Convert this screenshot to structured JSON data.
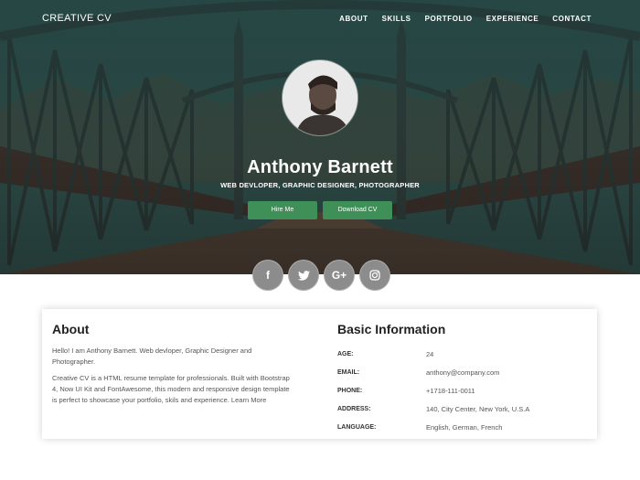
{
  "nav": {
    "brand": "Creative CV",
    "links": [
      "About",
      "Skills",
      "Portfolio",
      "Experience",
      "Contact"
    ]
  },
  "profile": {
    "name": "Anthony Barnett",
    "subtitle": "Web Devloper, Graphic Designer, Photographer",
    "hire_label": "Hire Me",
    "cv_label": "Download CV"
  },
  "social": [
    {
      "icon": "facebook-icon",
      "glyph": "f"
    },
    {
      "icon": "twitter-icon",
      "glyph": "🐦"
    },
    {
      "icon": "google-plus-icon",
      "glyph": "G+"
    },
    {
      "icon": "instagram-icon",
      "glyph": "◎"
    }
  ],
  "about": {
    "title": "About",
    "para1": "Hello! I am Anthony Barnett. Web devloper, Graphic Designer and Photographer.",
    "para2": "Creative CV is a HTML resume template for professionals. Built with Bootstrap 4, Now UI Kit and FontAwesome, this modern and responsive design template is perfect to showcase your portfolio, skils and experience. Learn More"
  },
  "basic_info": {
    "title": "Basic Information",
    "rows": [
      {
        "label": "Age:",
        "value": "24"
      },
      {
        "label": "Email:",
        "value": "anthony@company.com"
      },
      {
        "label": "Phone:",
        "value": "+1718-111-0011"
      },
      {
        "label": "Address:",
        "value": "140, City Center, New York, U.S.A"
      },
      {
        "label": "Language:",
        "value": "English, German, French"
      }
    ]
  },
  "colors": {
    "accent": "#3f8f59",
    "social_bg": "#8c8c8c"
  }
}
